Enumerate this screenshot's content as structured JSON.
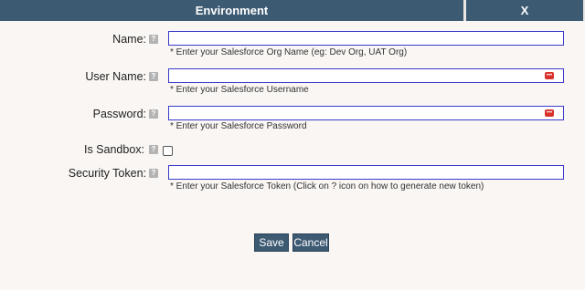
{
  "header": {
    "title": "Environment",
    "close_label": "X"
  },
  "help_glyph": "?",
  "fields": {
    "name": {
      "label": "Name:",
      "value": "",
      "hint": "* Enter your Salesforce Org Name (eg: Dev Org, UAT Org)"
    },
    "username": {
      "label": "User Name:",
      "value": "",
      "hint": "* Enter your Salesforce Username"
    },
    "password": {
      "label": "Password:",
      "value": "",
      "hint": "* Enter your Salesforce Password"
    },
    "sandbox": {
      "label": "Is Sandbox:",
      "checked": false
    },
    "token": {
      "label": "Security Token:",
      "value": "",
      "hint": "* Enter your Salesforce Token (Click on ? icon on how to generate new token)"
    }
  },
  "buttons": {
    "save": "Save",
    "cancel": "Cancel"
  },
  "colors": {
    "header": "#3d5a73",
    "background": "#f9f6f3",
    "field_border": "#3a3ac8",
    "key_icon": "#d9322b"
  },
  "icons": {
    "help": "help-icon",
    "password_manager": "key-icon"
  }
}
